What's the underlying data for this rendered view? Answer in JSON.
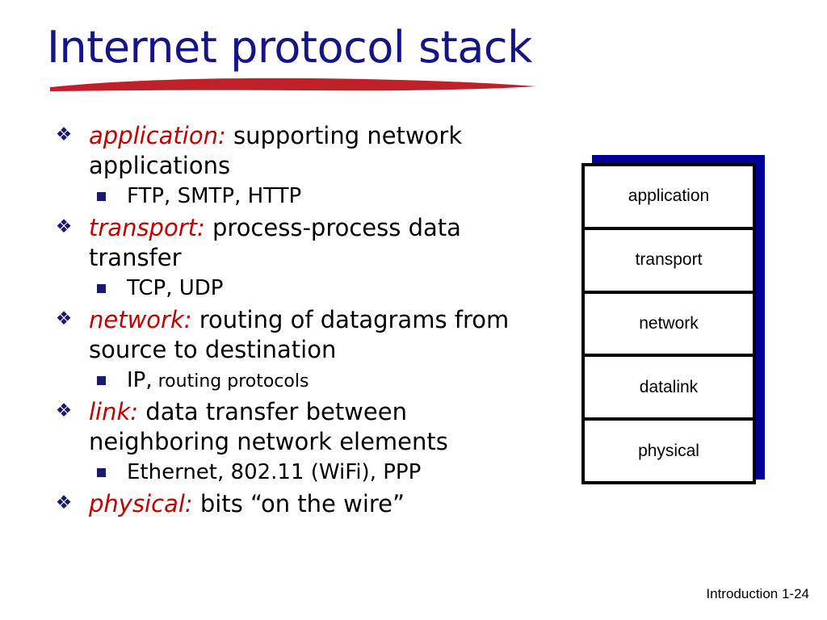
{
  "slide": {
    "title": "Internet protocol stack",
    "title_color": "#151585",
    "underline_color": "#C02028",
    "term_color": "#C00000",
    "bullet_color": "#191970",
    "footer": "Introduction 1-24"
  },
  "bullets": [
    {
      "bullet_glyph": "❖",
      "term": "application:",
      "text": " supporting network applications",
      "sub": [
        {
          "bullet_glyph": "▪",
          "text": "FTP, SMTP, HTTP",
          "small_tail": ""
        }
      ]
    },
    {
      "bullet_glyph": "❖",
      "term": "transport:",
      "text": " process-process data transfer",
      "sub": [
        {
          "bullet_glyph": "▪",
          "text": "TCP, UDP",
          "small_tail": ""
        }
      ]
    },
    {
      "bullet_glyph": "❖",
      "term": "network:",
      "text": " routing of datagrams from source to destination",
      "sub": [
        {
          "bullet_glyph": "▪",
          "text": "IP,",
          "small_tail": " routing protocols"
        }
      ]
    },
    {
      "bullet_glyph": "❖",
      "term": "link:",
      "text": " data transfer between neighboring  network elements",
      "sub": [
        {
          "bullet_glyph": "▪",
          "text": "Ethernet, 802.11 (WiFi), PPP",
          "small_tail": ""
        }
      ]
    },
    {
      "bullet_glyph": "❖",
      "term": "physical:",
      "text": " bits “on the wire”",
      "sub": []
    }
  ],
  "stack_diagram": {
    "shadow_color": "#000099",
    "border_color": "#000000",
    "layers": [
      {
        "label": "application"
      },
      {
        "label": "transport"
      },
      {
        "label": "network"
      },
      {
        "label": "datalink"
      },
      {
        "label": "physical"
      }
    ]
  }
}
